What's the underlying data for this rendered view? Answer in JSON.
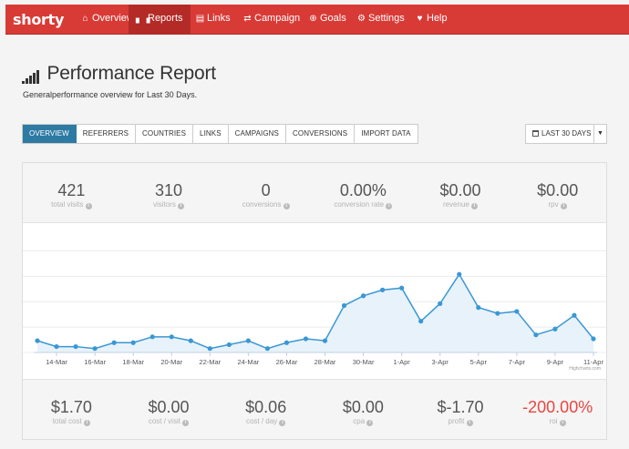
{
  "nav": {
    "brand": "shorty",
    "items": [
      {
        "label": "Overview",
        "icon": "home-icon",
        "glyph": "⌂"
      },
      {
        "label": "Reports",
        "icon": "bar-chart-icon",
        "glyph": "▖▗"
      },
      {
        "label": "Links",
        "icon": "list-icon",
        "glyph": "▤"
      },
      {
        "label": "Campaign",
        "icon": "shuffle-icon",
        "glyph": "⇄"
      },
      {
        "label": "Goals",
        "icon": "crosshair-icon",
        "glyph": "⊕"
      },
      {
        "label": "Settings",
        "icon": "gears-icon",
        "glyph": "⚙"
      },
      {
        "label": "Help",
        "icon": "heart-icon",
        "glyph": "♥"
      }
    ],
    "active": "Reports",
    "color": "#d83b36"
  },
  "header": {
    "title": "Performance Report",
    "subtitle": "Generalperformance overview for Last 30 Days."
  },
  "tabs": [
    "OVERVIEW",
    "REFERRERS",
    "COUNTRIES",
    "LINKS",
    "CAMPAIGNS",
    "CONVERSIONS",
    "IMPORT DATA"
  ],
  "active_tab": "OVERVIEW",
  "date_range": {
    "label": "LAST 30 DAYS",
    "icon": "calendar-icon"
  },
  "stats_top": [
    {
      "value": "421",
      "label": "total visits"
    },
    {
      "value": "310",
      "label": "visitors"
    },
    {
      "value": "0",
      "label": "conversions"
    },
    {
      "value": "0.00%",
      "label": "conversion rate"
    },
    {
      "value": "$0.00",
      "label": "revenue"
    },
    {
      "value": "$0.00",
      "label": "rpv"
    }
  ],
  "stats_bottom": [
    {
      "value": "$1.70",
      "label": "total cost"
    },
    {
      "value": "$0.00",
      "label": "cost / visit"
    },
    {
      "value": "$0.06",
      "label": "cost / day"
    },
    {
      "value": "$0.00",
      "label": "cpa"
    },
    {
      "value": "$-1.70",
      "label": "profit"
    },
    {
      "value": "-200.00%",
      "label": "roi",
      "negative": true
    }
  ],
  "chart_credit": "Highcharts.com",
  "chart_data": {
    "type": "area",
    "x": [
      "13-Mar",
      "14-Mar",
      "15-Mar",
      "16-Mar",
      "17-Mar",
      "18-Mar",
      "19-Mar",
      "20-Mar",
      "21-Mar",
      "22-Mar",
      "23-Mar",
      "24-Mar",
      "25-Mar",
      "26-Mar",
      "27-Mar",
      "28-Mar",
      "29-Mar",
      "30-Mar",
      "31-Mar",
      "1-Apr",
      "2-Apr",
      "3-Apr",
      "4-Apr",
      "5-Apr",
      "6-Apr",
      "7-Apr",
      "8-Apr",
      "9-Apr",
      "10-Apr",
      "11-Apr"
    ],
    "tick_labels": [
      "14-Mar",
      "16-Mar",
      "18-Mar",
      "20-Mar",
      "22-Mar",
      "24-Mar",
      "26-Mar",
      "28-Mar",
      "30-Mar",
      "1-Apr",
      "3-Apr",
      "5-Apr",
      "7-Apr",
      "9-Apr",
      "11-Apr"
    ],
    "series": [
      {
        "values": [
          6,
          3,
          3,
          2,
          5,
          5,
          8,
          8,
          6,
          2,
          4,
          6,
          2,
          5,
          7,
          6,
          24,
          29,
          32,
          33,
          16,
          25,
          40,
          23,
          20,
          21,
          9,
          12,
          19,
          7
        ]
      }
    ],
    "ylim": [
      0,
      55
    ],
    "grid": true,
    "line_color": "#3a97d4",
    "fill_color": "#e8f2fa"
  }
}
